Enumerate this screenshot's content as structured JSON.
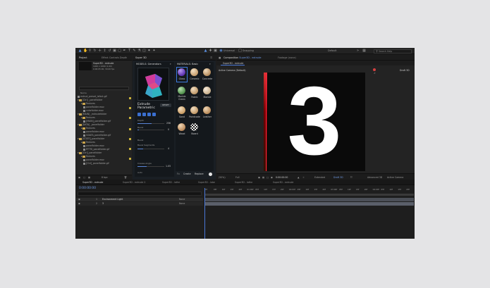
{
  "menu": {
    "mode": "Default",
    "search": "Search Help",
    "universal": "Universal",
    "snapping": "Snapping"
  },
  "project": {
    "tab": "Project",
    "effects_tab": "Effect Controls Depth",
    "item_name": "Super3D - extrude",
    "item_sub1": "1920 x 1080 (1.00)",
    "item_sub2": "0:00:05:00, 30.00 fps",
    "search_ph": "",
    "name_header": "Name",
    "rows": [
      "extrud_preset_lefect.gif",
      "[Ctrl] _panelfolder",
      "Textures",
      "panelfolder.mov",
      "colorfolder.mov",
      "[MAIN] _extrudefolder",
      "Textures",
      "[MAIN]_panelfolder.gif",
      "[DATA] _panelfolder",
      "Textures",
      "panelfolder.mov",
      "GDATA_panelfolder.gif",
      "[STATE]_panelfolder",
      "Textures",
      "panelfolder.mov",
      "RTTRI_panelfolder.gif",
      "[Ctrl]_panelfolder",
      "Textures",
      "panelfolder.mov",
      "[Ctrl]_panelfolder.gif"
    ],
    "bpc": "8 bpc"
  },
  "super3d": {
    "tab": "Super 3D",
    "models_header": "MODELS: Generators",
    "model_name": "Extrude Parametric",
    "reset": "RESET",
    "depth_label": "Depth",
    "depth_val": "256",
    "bevel_label": "Bevel",
    "bevel_val": "0",
    "bevel_seg_label": "Bevel Segments",
    "bevel_seg_val": "4",
    "crease_label": "Crease Angle",
    "crease_val": "1.05",
    "auto_label": "Auto"
  },
  "materials": {
    "header": "MATERIALS: Basic",
    "items": [
      "Gloss",
      "Ceramic",
      "Concrete",
      "Marble Green",
      "Fabric",
      "Marble",
      "Sand",
      "Paintcode",
      "Leather",
      "Wood",
      "Board"
    ],
    "fx": "Fx",
    "create": "Create",
    "replace": "Replace"
  },
  "comp": {
    "tab": "Composition",
    "tab_name": "Super3D - extrude",
    "footage": "Footage (none)",
    "subtab": "Super3D - extrude",
    "camera": "Active Camera (Default)",
    "draft": "Draft 3D",
    "big": "3",
    "zoom": "(50%)",
    "quality": "Full",
    "renderer": "Advanced 3D",
    "camera_ctrl": "Active Camera",
    "view": "1 View",
    "time": "0:00:00:00",
    "draft3d": "Draft 3D",
    "extended": "Extended"
  },
  "timeline": {
    "tabs": [
      "Super3D - extrude",
      "Super3D - extrude 2",
      "Super3D - lathe",
      "Super3D - lobe",
      "Super3D - lathe",
      "Super3D - extrude"
    ],
    "time": "0:00:00:00",
    "layers": [
      {
        "num": "1",
        "name": "Environment Light",
        "mode": "None"
      },
      {
        "num": "2",
        "name": "3",
        "mode": "None"
      }
    ],
    "ruler": [
      "0f",
      "05f",
      "10f",
      "15f",
      "20f",
      "01:00f",
      "05f",
      "10f",
      "15f",
      "20f",
      "02:00f",
      "05f",
      "10f",
      "15f",
      "20f",
      "03:00f",
      "05f",
      "10f",
      "15f",
      "20f",
      "04:00f",
      "05f",
      "10f",
      "15f",
      "20f"
    ]
  }
}
